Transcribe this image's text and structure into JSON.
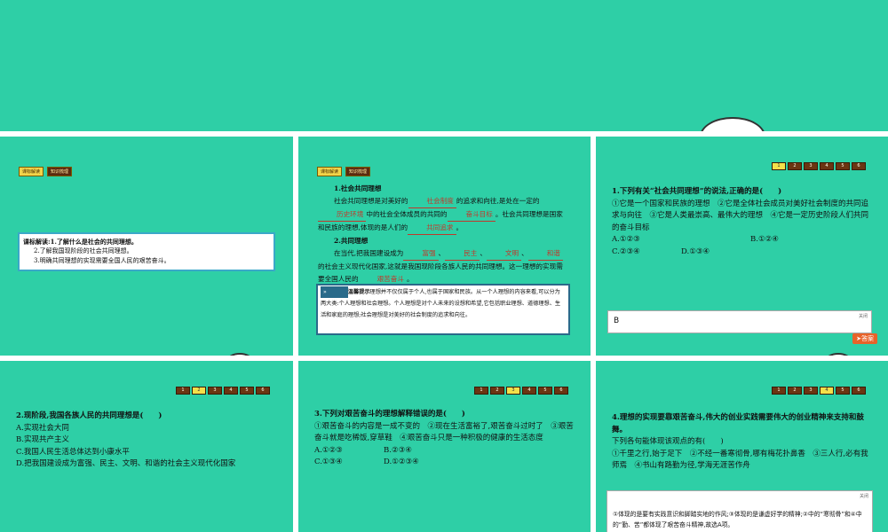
{
  "slide1": {
    "tags": [
      "课标解读",
      "知识梳理"
    ],
    "objectives": [
      "课标解读:1.了解什么是社会的共同理想。",
      "2.了解我国现阶段的社会共同理想。",
      "3.明确共同理想的实现需要全国人民的艰苦奋斗。"
    ]
  },
  "slide2": {
    "tags": [
      "课标解读",
      "知识梳理"
    ],
    "h1": "1.社会共同理想",
    "p1a": "社会共同理想是对美好的",
    "b1": "社会制度",
    "p1b": "的追求和向往,是处在一定的",
    "b2": "历史环境",
    "p1c": "中的社会全体成员的共同的",
    "b3": "奋斗目标",
    "p1d": "。社会共同理想是国家和民族的理想,体现的是人们的",
    "b4": "共同追求",
    "p1e": "。",
    "h2": "2.共同理想",
    "p2a": "在当代,把我国建设成为",
    "b5": "富强",
    "b6": "民主",
    "b7": "文明",
    "b8": "和谐",
    "p2b": "的社会主义现代化国家,这就是我国现阶段各族人民的共同理想。这一理想的实现需要全国人民的",
    "b9": "艰苦奋斗",
    "p2c": "。",
    "tip_label": "温馨提示",
    "tip_text": "理想并不仅仅属于个人,也属于国家和民族。从一个人理想的内容来看,可以分为两大类:个人理想和社会理想。个人理想是对个人未来的设想和希望,它包括职业理想、道德理想、生活和家庭的理想;社会理想是对美好的社会制度的追求和向往。"
  },
  "slide3": {
    "pages": [
      "1",
      "2",
      "3",
      "4",
      "5",
      "6"
    ],
    "current": "1",
    "question": "1.下列有关“社会共同理想”的说法,正确的是(　　)",
    "items": "①它是一个国家和民族的理想　②它是全体社会成员对美好社会制度的共同追求与向往　③它是人类最崇高、最伟大的理想　④它是一定历史阶段人们共同的奋斗目标",
    "optA": "A.①②③",
    "optB": "B.①②④",
    "optC": "C.②③④",
    "optD": "D.①③④",
    "answer": "B",
    "close": "关闭",
    "answer_btn": "答案"
  },
  "slide4": {
    "pages": [
      "1",
      "2",
      "3",
      "4",
      "5",
      "6"
    ],
    "current": "2",
    "question": "2.现阶段,我国各族人民的共同理想是(　　)",
    "optA": "A.实现社会大同",
    "optB": "B.实现共产主义",
    "optC": "C.我国人民生活总体达到小康水平",
    "optD": "D.把我国建设成为富强、民主、文明、和谐的社会主义现代化国家"
  },
  "slide5": {
    "pages": [
      "1",
      "2",
      "3",
      "4",
      "5",
      "6"
    ],
    "current": "3",
    "question": "3.下列对艰苦奋斗的理想解释错误的是(　　)",
    "items": "①艰苦奋斗的内容是一成不变的　②现在生活富裕了,艰苦奋斗过时了　③艰苦奋斗就是吃稀饭,穿草鞋　④艰苦奋斗只是一种积极的健康的生活态度",
    "optA": "A.①②③",
    "optB": "B.②③④",
    "optC": "C.①③④",
    "optD": "D.①②③④"
  },
  "slide6": {
    "pages": [
      "1",
      "2",
      "3",
      "4",
      "5",
      "6"
    ],
    "current": "4",
    "question": "4.理想的实现要靠艰苦奋斗,伟大的创业实践需要伟大的创业精神来支持和鼓舞。",
    "sub": "下列各句能体现该观点的有(　　)",
    "items": "①千里之行,始于足下　②不经一番寒彻骨,哪有梅花扑鼻香　③三人行,必有我师焉　④书山有路勤为径,学海无涯苦作舟",
    "close": "关闭",
    "explain": "①体现的是要有实践意识和脚踏实地的作风;③体现的是谦虚好学的精神;②中的“寒彻骨”和④中的“勤、苦”都体现了艰苦奋斗精神,故选A项。"
  }
}
